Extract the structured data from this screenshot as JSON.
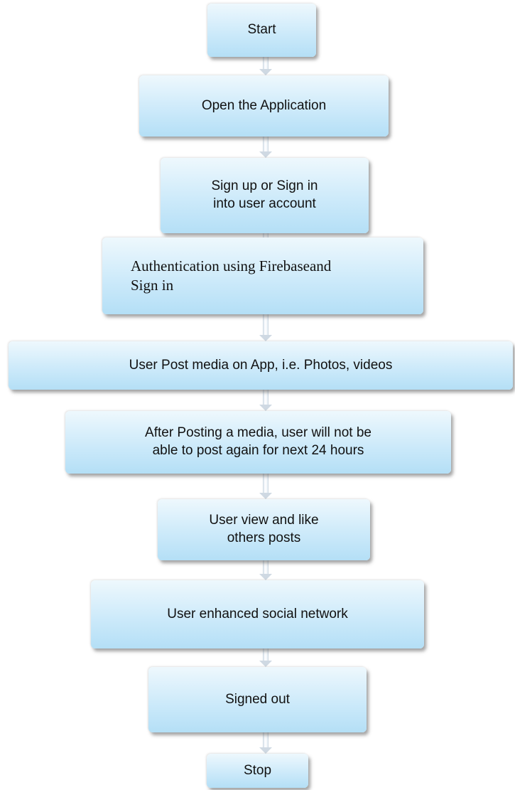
{
  "steps": [
    {
      "label": "Start"
    },
    {
      "label": "Open the Application"
    },
    {
      "label": "Sign up or Sign in\ninto user account"
    },
    {
      "label": "Authentication using Firebaseand\n      Sign in"
    },
    {
      "label": "User Post media on App, i.e. Photos, videos"
    },
    {
      "label": "After Posting a media, user will not be\nable to post again for next 24 hours"
    },
    {
      "label": "User view and like\nothers posts"
    },
    {
      "label": "User enhanced social network"
    },
    {
      "label": "Signed out"
    },
    {
      "label": "Stop"
    }
  ]
}
